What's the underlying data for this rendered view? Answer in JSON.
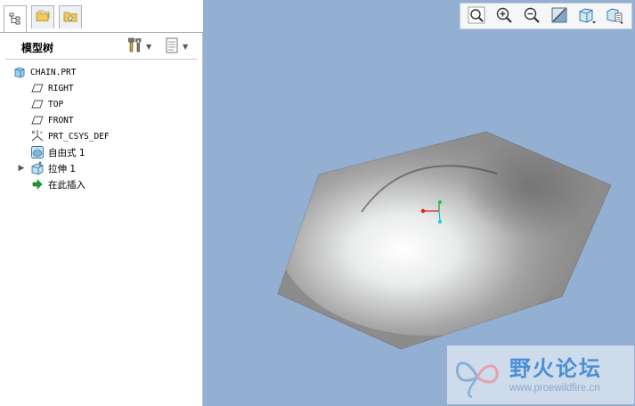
{
  "model_tree": {
    "title": "模型树",
    "items": [
      {
        "label": "CHAIN.PRT",
        "icon": "part-icon",
        "mono": true
      },
      {
        "label": "RIGHT",
        "icon": "datum-plane-icon",
        "mono": true
      },
      {
        "label": "TOP",
        "icon": "datum-plane-icon",
        "mono": true
      },
      {
        "label": "FRONT",
        "icon": "datum-plane-icon",
        "mono": true
      },
      {
        "label": "PRT_CSYS_DEF",
        "icon": "csys-icon",
        "mono": true
      },
      {
        "label": "自由式 1",
        "icon": "freestyle-icon",
        "mono": false
      },
      {
        "label": "拉伸 1",
        "icon": "extrude-icon",
        "mono": false,
        "expandable": true
      },
      {
        "label": "在此插入",
        "icon": "insert-here-arrow-icon",
        "mono": false
      }
    ]
  },
  "view_toolbar": {
    "buttons": [
      "zoom-fit-icon",
      "zoom-in-icon",
      "zoom-out-icon",
      "repaint-icon",
      "display-style-icon",
      "saved-views-icon"
    ]
  },
  "watermark": {
    "title": "野火论坛",
    "url": "www.proewildfire.cn"
  },
  "colors": {
    "viewport_bg": "#93b0d3",
    "surface": "#8c8c8c",
    "accent": "#2a6fc9"
  }
}
